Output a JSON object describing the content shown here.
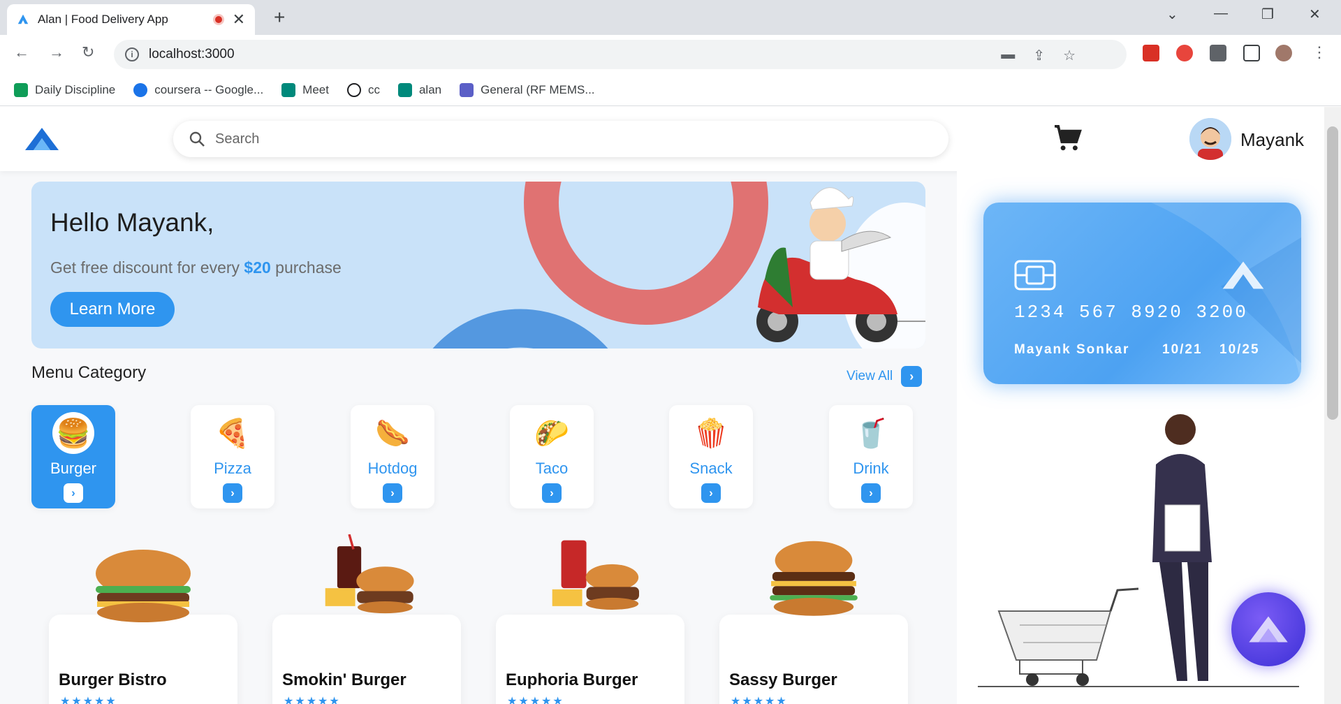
{
  "browser": {
    "tab_title": "Alan | Food Delivery App",
    "url": "localhost:3000",
    "bookmarks": [
      {
        "label": "Daily Discipline",
        "color": "#0f9d58"
      },
      {
        "label": "coursera -- Google...",
        "color": "#1a73e8"
      },
      {
        "label": "Meet",
        "color": "#00897b"
      },
      {
        "label": "cc",
        "color": "#202124"
      },
      {
        "label": "alan",
        "color": "#00897b"
      },
      {
        "label": "General (RF MEMS...",
        "color": "#5b5fc7"
      }
    ]
  },
  "header": {
    "search_placeholder": "Search",
    "user_name": "Mayank"
  },
  "banner": {
    "greeting": "Hello Mayank,",
    "promo_before": "Get free discount for every ",
    "promo_amount": "$20",
    "promo_after": " purchase",
    "button": "Learn More"
  },
  "menu": {
    "title": "Menu Category",
    "view_all": "View All",
    "categories": [
      {
        "label": "Burger",
        "icon": "🍔",
        "active": true
      },
      {
        "label": "Pizza",
        "icon": "🍕",
        "active": false
      },
      {
        "label": "Hotdog",
        "icon": "🌭",
        "active": false
      },
      {
        "label": "Taco",
        "icon": "🌮",
        "active": false
      },
      {
        "label": "Snack",
        "icon": "🍿",
        "active": false
      },
      {
        "label": "Drink",
        "icon": "🥤",
        "active": false
      }
    ]
  },
  "products": [
    {
      "name": "Burger Bistro",
      "rating": "★★★★★"
    },
    {
      "name": "Smokin' Burger",
      "rating": "★★★★★"
    },
    {
      "name": "Euphoria Burger",
      "rating": "★★★★★"
    },
    {
      "name": "Sassy Burger",
      "rating": "★★★★★"
    }
  ],
  "card": {
    "number": "1234 567 8920 3200",
    "holder": "Mayank Sonkar",
    "valid_from": "10/21",
    "valid_to": "10/25"
  },
  "colors": {
    "accent": "#2f95ef",
    "assistant": "#4b3ae0"
  }
}
